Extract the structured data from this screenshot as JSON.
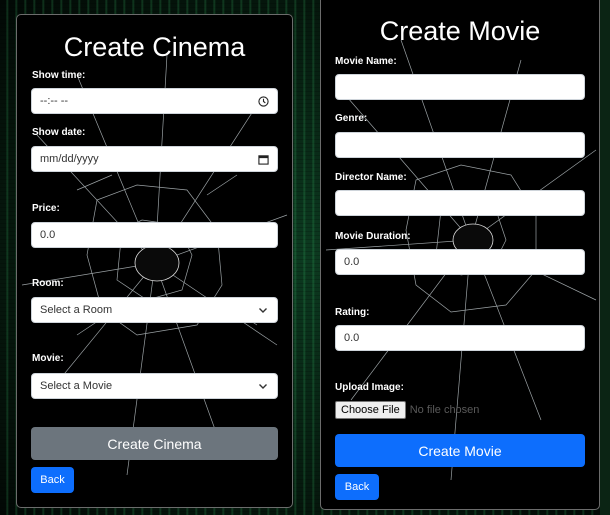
{
  "cinema_form": {
    "title": "Create Cinema",
    "show_time_label": "Show time:",
    "show_time_value": "--:-- --",
    "show_date_label": "Show date:",
    "show_date_value": "mm/dd/yyyy",
    "price_label": "Price:",
    "price_value": "0.0",
    "room_label": "Room:",
    "room_selected": "Select a Room",
    "movie_label": "Movie:",
    "movie_selected": "Select a Movie",
    "submit_label": "Create Cinema",
    "back_label": "Back"
  },
  "movie_form": {
    "title": "Create Movie",
    "name_label": "Movie Name:",
    "genre_label": "Genre:",
    "director_label": "Director Name:",
    "duration_label": "Movie Duration:",
    "duration_value": "0.0",
    "rating_label": "Rating:",
    "rating_value": "0.0",
    "upload_label": "Upload Image:",
    "choose_file_label": "Choose File",
    "no_file_text": "No file chosen",
    "submit_label": "Create Movie",
    "back_label": "Back"
  },
  "colors": {
    "primary": "#0d6efd",
    "secondary": "#6c757d",
    "panel_bg": "#000000"
  },
  "icons": {
    "time": "clock-icon",
    "date": "calendar-icon",
    "select": "chevron-down-icon"
  }
}
